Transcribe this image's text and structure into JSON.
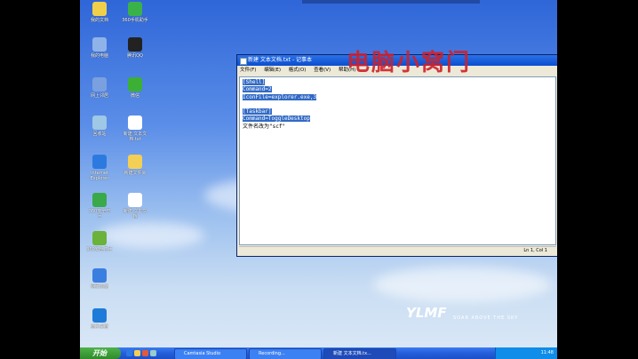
{
  "desktop_icons": [
    {
      "label": "我的文档",
      "color": "#f0d04a"
    },
    {
      "label": "360手机助手",
      "color": "#3ab24a"
    },
    {
      "label": "我的电脑",
      "color": "#8fb3e8"
    },
    {
      "label": "腾讯QQ",
      "color": "#222"
    },
    {
      "label": "网上邻居",
      "color": "#7aa0e0"
    },
    {
      "label": "微信",
      "color": "#3cb035"
    },
    {
      "label": "回收站",
      "color": "#9fc7e6"
    },
    {
      "label": "新建 文本文\n档.txt",
      "color": "#ffffff"
    },
    {
      "label": "Internet\nExplorer",
      "color": "#2c7ae0"
    },
    {
      "label": "新建文件夹",
      "color": "#f3cf55"
    },
    {
      "label": "360安全卫\n士",
      "color": "#3aa94a"
    },
    {
      "label": "新建 文本文\n档",
      "color": "#ffffff"
    },
    {
      "label": "360安全卫士",
      "color": "#6ab23a"
    },
    {
      "label": "网页浏览",
      "color": "#3a7fe0"
    },
    {
      "label": "显示桌面",
      "color": "#1f7bd8"
    }
  ],
  "notepad": {
    "title": "新建 文本文档.txt - 记事本",
    "menu": [
      "文件(F)",
      "编辑(E)",
      "格式(O)",
      "查看(V)",
      "帮助(H)"
    ],
    "lines": [
      {
        "text": "[Shell]",
        "selected": true
      },
      {
        "text": "Command=2",
        "selected": true
      },
      {
        "text": "IconFile=explorer.exe,3",
        "selected": true
      },
      {
        "text": "",
        "selected": false
      },
      {
        "text": "[Taskbar]",
        "selected": true
      },
      {
        "text": "Command=ToggleDesktop",
        "selected": true
      },
      {
        "text": "文件名改为\"scf\"",
        "selected": false
      }
    ],
    "status": "Ln 1, Col 1"
  },
  "watermark": "电脑小窝门",
  "logo": {
    "text": "YLMF",
    "tagline": "SOAR ABOVE THE SKY"
  },
  "taskbar": {
    "start_label": "开始",
    "buttons": [
      "Camtasia Studio",
      "Recording...",
      "新建 文本文档.tx..."
    ],
    "clock": "11:48"
  }
}
